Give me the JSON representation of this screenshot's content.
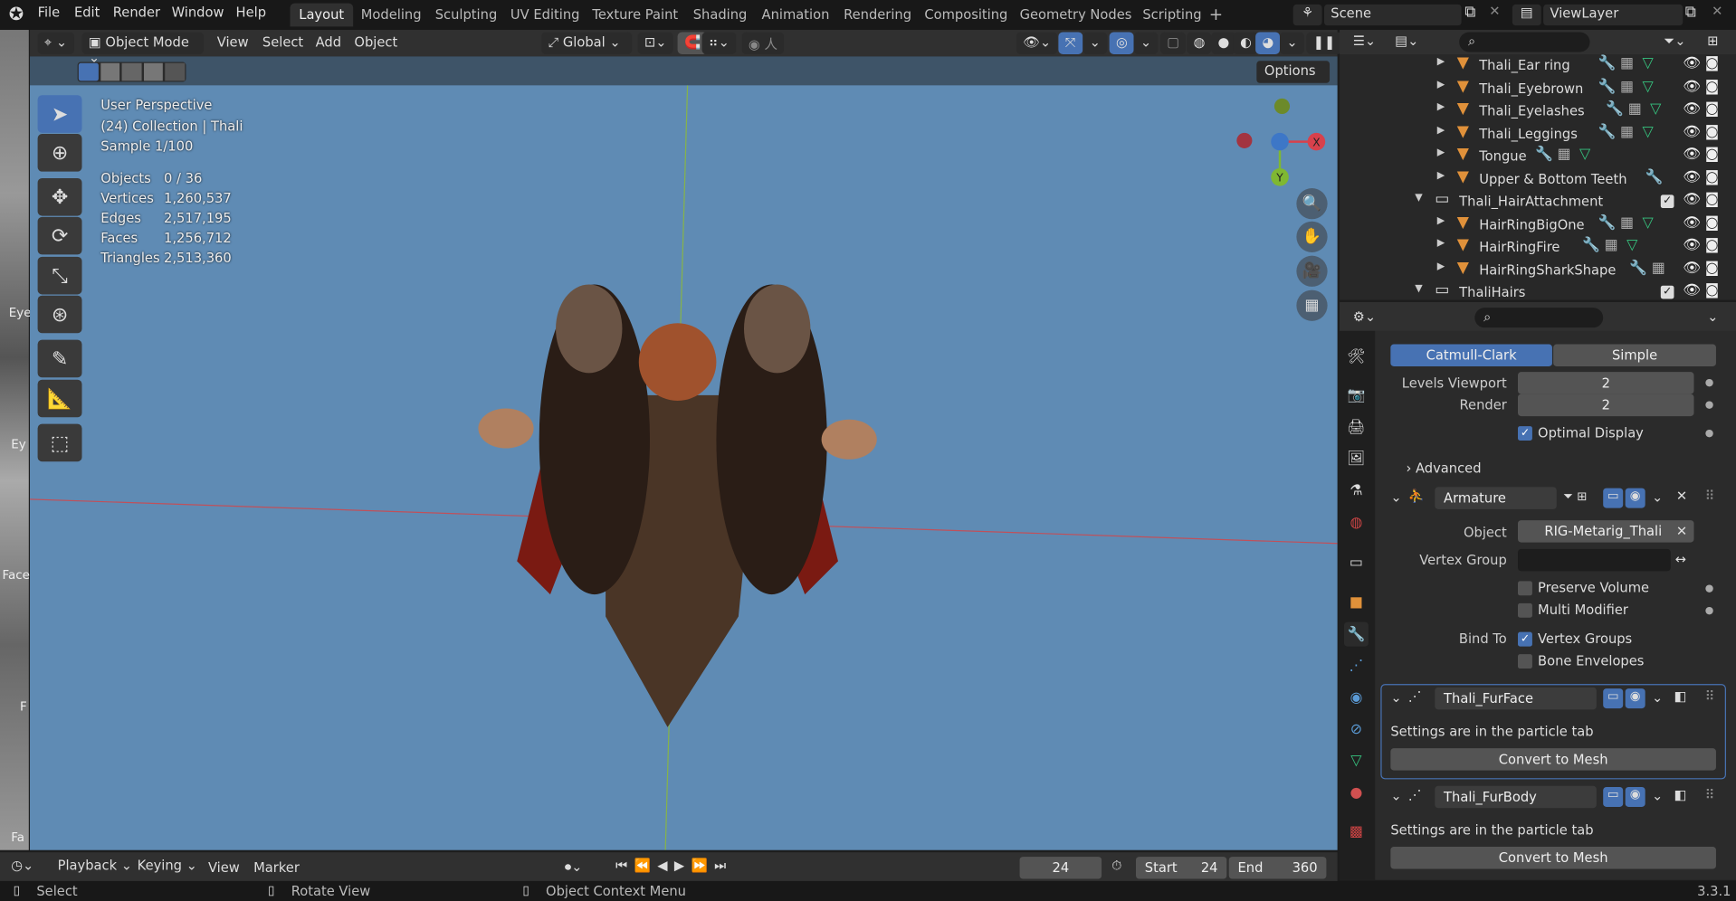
{
  "app": {
    "version": "3.3.1"
  },
  "menu": [
    "File",
    "Edit",
    "Render",
    "Window",
    "Help"
  ],
  "workspaces": [
    {
      "label": "Layout",
      "active": true
    },
    {
      "label": "Modeling"
    },
    {
      "label": "Sculpting"
    },
    {
      "label": "UV Editing"
    },
    {
      "label": "Texture Paint"
    },
    {
      "label": "Shading"
    },
    {
      "label": "Animation"
    },
    {
      "label": "Rendering"
    },
    {
      "label": "Compositing"
    },
    {
      "label": "Geometry Nodes"
    },
    {
      "label": "Scripting"
    }
  ],
  "add_workspace": "+",
  "scene": "Scene",
  "view_layer": "ViewLayer",
  "header": {
    "mode": "Object Mode",
    "view": "View",
    "select": "Select",
    "add": "Add",
    "object": "Object",
    "orientation": "Global",
    "options": "Options"
  },
  "viewport": {
    "perspective": "User Perspective",
    "collection": "(24) Collection | Thali",
    "sample": "Sample 1/100",
    "stats": [
      {
        "label": "Objects",
        "value": "0 / 36"
      },
      {
        "label": "Vertices",
        "value": "1,260,537"
      },
      {
        "label": "Edges",
        "value": "2,517,195"
      },
      {
        "label": "Faces",
        "value": "1,256,712"
      },
      {
        "label": "Triangles",
        "value": "2,513,360"
      }
    ],
    "gizmo": {
      "x": "X",
      "y": "Y"
    },
    "background_color": "#5f8bb4"
  },
  "left_strip": [
    "Eye",
    "Ey",
    "Face",
    "F",
    "Fa"
  ],
  "outliner": {
    "items": [
      {
        "name": "Thali_Ear ring",
        "type": "mesh",
        "icons": [
          "modifier",
          "vertex-groups",
          "mesh-data"
        ]
      },
      {
        "name": "Thali_Eyebrown",
        "type": "mesh",
        "icons": [
          "modifier",
          "vertex-groups",
          "mesh-data"
        ]
      },
      {
        "name": "Thali_Eyelashes",
        "type": "mesh",
        "icons": [
          "modifier",
          "vertex-groups",
          "mesh-data"
        ]
      },
      {
        "name": "Thali_Leggings",
        "type": "mesh",
        "icons": [
          "modifier",
          "vertex-groups",
          "mesh-data"
        ]
      },
      {
        "name": "Tongue",
        "type": "mesh",
        "icons": [
          "modifier",
          "vertex-groups",
          "mesh-data"
        ]
      },
      {
        "name": "Upper & Bottom Teeth",
        "type": "mesh",
        "icons": [
          "modifier"
        ]
      },
      {
        "name": "Thali_HairAttachment",
        "type": "collection",
        "checked": true
      },
      {
        "name": "HairRingBigOne",
        "type": "mesh",
        "icons": [
          "modifier",
          "vertex-groups",
          "mesh-data"
        ]
      },
      {
        "name": "HairRingFire",
        "type": "mesh",
        "icons": [
          "modifier",
          "vertex-groups",
          "mesh-data"
        ]
      },
      {
        "name": "HairRingSharkShape",
        "type": "mesh",
        "icons": [
          "modifier",
          "vertex-groups"
        ]
      },
      {
        "name": "ThaliHairs",
        "type": "collection",
        "checked": true
      }
    ]
  },
  "properties": {
    "subdivision": {
      "catmull": "Catmull-Clark",
      "simple": "Simple",
      "levels_label": "Levels Viewport",
      "levels": "2",
      "render_label": "Render",
      "render": "2",
      "optimal": "Optimal Display",
      "optimal_checked": true,
      "advanced": "Advanced"
    },
    "armature": {
      "name": "Armature",
      "object_label": "Object",
      "object": "RIG-Metarig_Thali",
      "vgroup_label": "Vertex Group",
      "vgroup": "",
      "preserve": "Preserve Volume",
      "multi": "Multi Modifier",
      "bind_label": "Bind To",
      "vertex_groups": "Vertex Groups",
      "vertex_groups_checked": true,
      "bone_env": "Bone Envelopes"
    },
    "particles": [
      {
        "name": "Thali_FurFace (ParticleSy...",
        "info": "Settings are in the particle tab",
        "convert": "Convert to Mesh"
      },
      {
        "name": "Thali_FurBody (ParticleSy...",
        "info": "Settings are in the particle tab",
        "convert": "Convert to Mesh"
      }
    ]
  },
  "timeline": {
    "playback": "Playback",
    "keying": "Keying",
    "view": "View",
    "marker": "Marker",
    "frame": "24",
    "start_label": "Start",
    "start": "24",
    "end_label": "End",
    "end": "360"
  },
  "status": {
    "select": "Select",
    "rotate": "Rotate View",
    "context": "Object Context Menu"
  },
  "colors": {
    "accent": "#4772b3",
    "mesh_icon": "#e0913a",
    "modifier_icon": "#5b7fd6",
    "mesh_data_icon": "#36c47f",
    "x_axis": "#d8414c",
    "y_axis": "#7fb832",
    "z_axis": "#3d77c7"
  }
}
